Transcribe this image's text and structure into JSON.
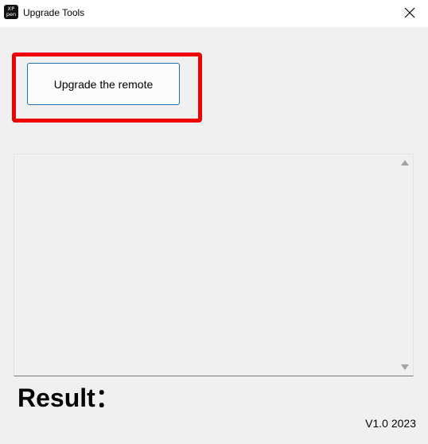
{
  "window": {
    "title": "Upgrade Tools",
    "logo_line1": "XP",
    "logo_line2": "pen",
    "close_icon": "close-icon"
  },
  "main": {
    "upgrade_button_label": "Upgrade the remote",
    "highlight_color": "#ee0000",
    "log_text": "",
    "result_label": "Result：",
    "version": "V1.0 2023"
  }
}
